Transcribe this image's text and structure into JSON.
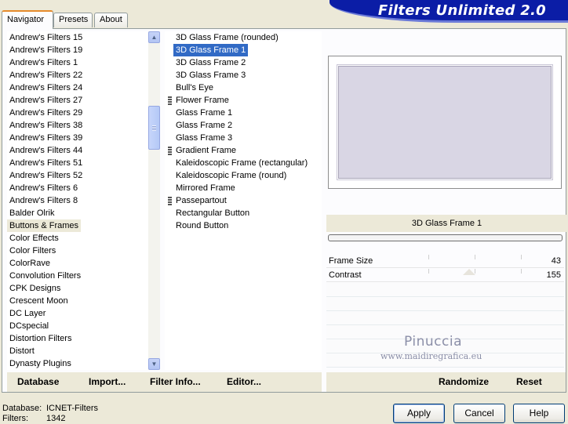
{
  "tabs": [
    "Navigator",
    "Presets",
    "About"
  ],
  "banner_title": "Filters Unlimited 2.0",
  "categories": [
    "Andrew's Filters 15",
    "Andrew's Filters 19",
    "Andrew's Filters 1",
    "Andrew's Filters 22",
    "Andrew's Filters 24",
    "Andrew's Filters 27",
    "Andrew's Filters 29",
    "Andrew's Filters 38",
    "Andrew's Filters 39",
    "Andrew's Filters 44",
    "Andrew's Filters 51",
    "Andrew's Filters 52",
    "Andrew's Filters 6",
    "Andrew's Filters 8",
    "Balder Olrik",
    "Buttons & Frames",
    "Color Effects",
    "Color Filters",
    "ColorRave",
    "Convolution Filters",
    "CPK Designs",
    "Crescent Moon",
    "DC Layer",
    "DCspecial",
    "Distortion Filters",
    "Distort",
    "Dynasty Plugins"
  ],
  "selected_category": "Buttons & Frames",
  "filters": [
    {
      "label": "3D Glass Frame (rounded)",
      "grip": false
    },
    {
      "label": "3D Glass Frame 1",
      "grip": false
    },
    {
      "label": "3D Glass Frame 2",
      "grip": false
    },
    {
      "label": "3D Glass Frame 3",
      "grip": false
    },
    {
      "label": "Bull's Eye",
      "grip": false
    },
    {
      "label": "Flower Frame",
      "grip": true
    },
    {
      "label": "Glass Frame 1",
      "grip": false
    },
    {
      "label": "Glass Frame 2",
      "grip": false
    },
    {
      "label": "Glass Frame 3",
      "grip": false
    },
    {
      "label": "Gradient Frame",
      "grip": true
    },
    {
      "label": "Kaleidoscopic Frame (rectangular)",
      "grip": false
    },
    {
      "label": "Kaleidoscopic Frame (round)",
      "grip": false
    },
    {
      "label": "Mirrored Frame",
      "grip": false
    },
    {
      "label": "Passepartout",
      "grip": true
    },
    {
      "label": "Rectangular Button",
      "grip": false
    },
    {
      "label": "Round Button",
      "grip": false
    }
  ],
  "selected_filter": "3D Glass Frame 1",
  "preview_filter_name": "3D Glass Frame 1",
  "parameters": [
    {
      "label": "Frame Size",
      "value": "43"
    },
    {
      "label": "Contrast",
      "value": "155"
    }
  ],
  "watermark": {
    "line1": "Pinuccia",
    "line2": "www.maidiregrafica.eu"
  },
  "left_commands": [
    "Database",
    "Import...",
    "Filter Info...",
    "Editor..."
  ],
  "right_commands": [
    "Randomize",
    "Reset"
  ],
  "footer": {
    "database_label": "Database:",
    "database_value": "ICNET-Filters",
    "filters_label": "Filters:",
    "filters_value": "1342"
  },
  "buttons": {
    "apply": "Apply",
    "cancel": "Cancel",
    "help": "Help"
  },
  "colors": {
    "selection": "#316ac5",
    "banner": "#0b1da6",
    "tab_accent": "#e68b2c"
  }
}
